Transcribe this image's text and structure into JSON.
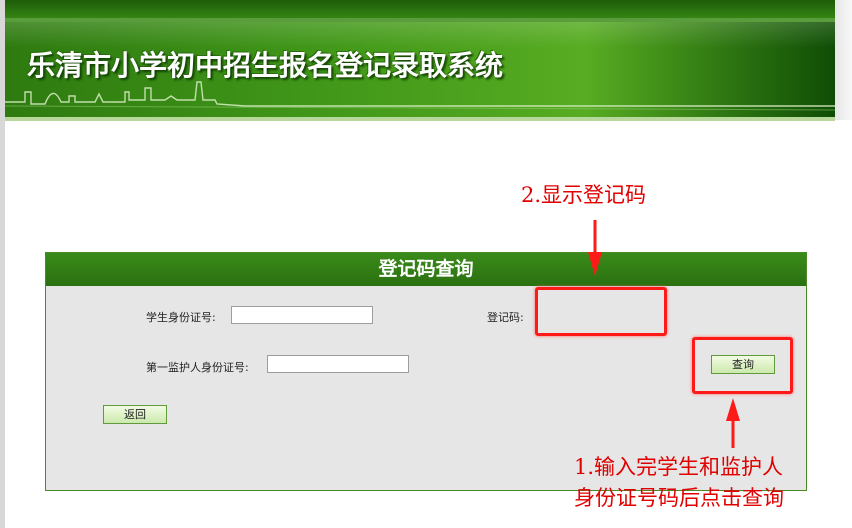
{
  "header": {
    "title": "乐清市小学初中招生报名登记录取系统"
  },
  "panel": {
    "title": "登记码查询",
    "fields": {
      "student_id_label": "学生身份证号:",
      "student_id_value": "",
      "guardian_id_label": "第一监护人身份证号:",
      "guardian_id_value": "",
      "reg_code_label": "登记码:",
      "reg_code_value": ""
    },
    "buttons": {
      "query": "查询",
      "back": "返回"
    }
  },
  "annotations": {
    "step2": "2.显示登记码",
    "step1_line1": "1.输入完学生和监护人",
    "step1_line2": "身份证号码后点击查询"
  },
  "colors": {
    "panel_header": "#2f7d15",
    "banner_green": "#3f9518",
    "annotation_red": "#ff1a1a",
    "panel_bg": "#e6e6e6"
  }
}
